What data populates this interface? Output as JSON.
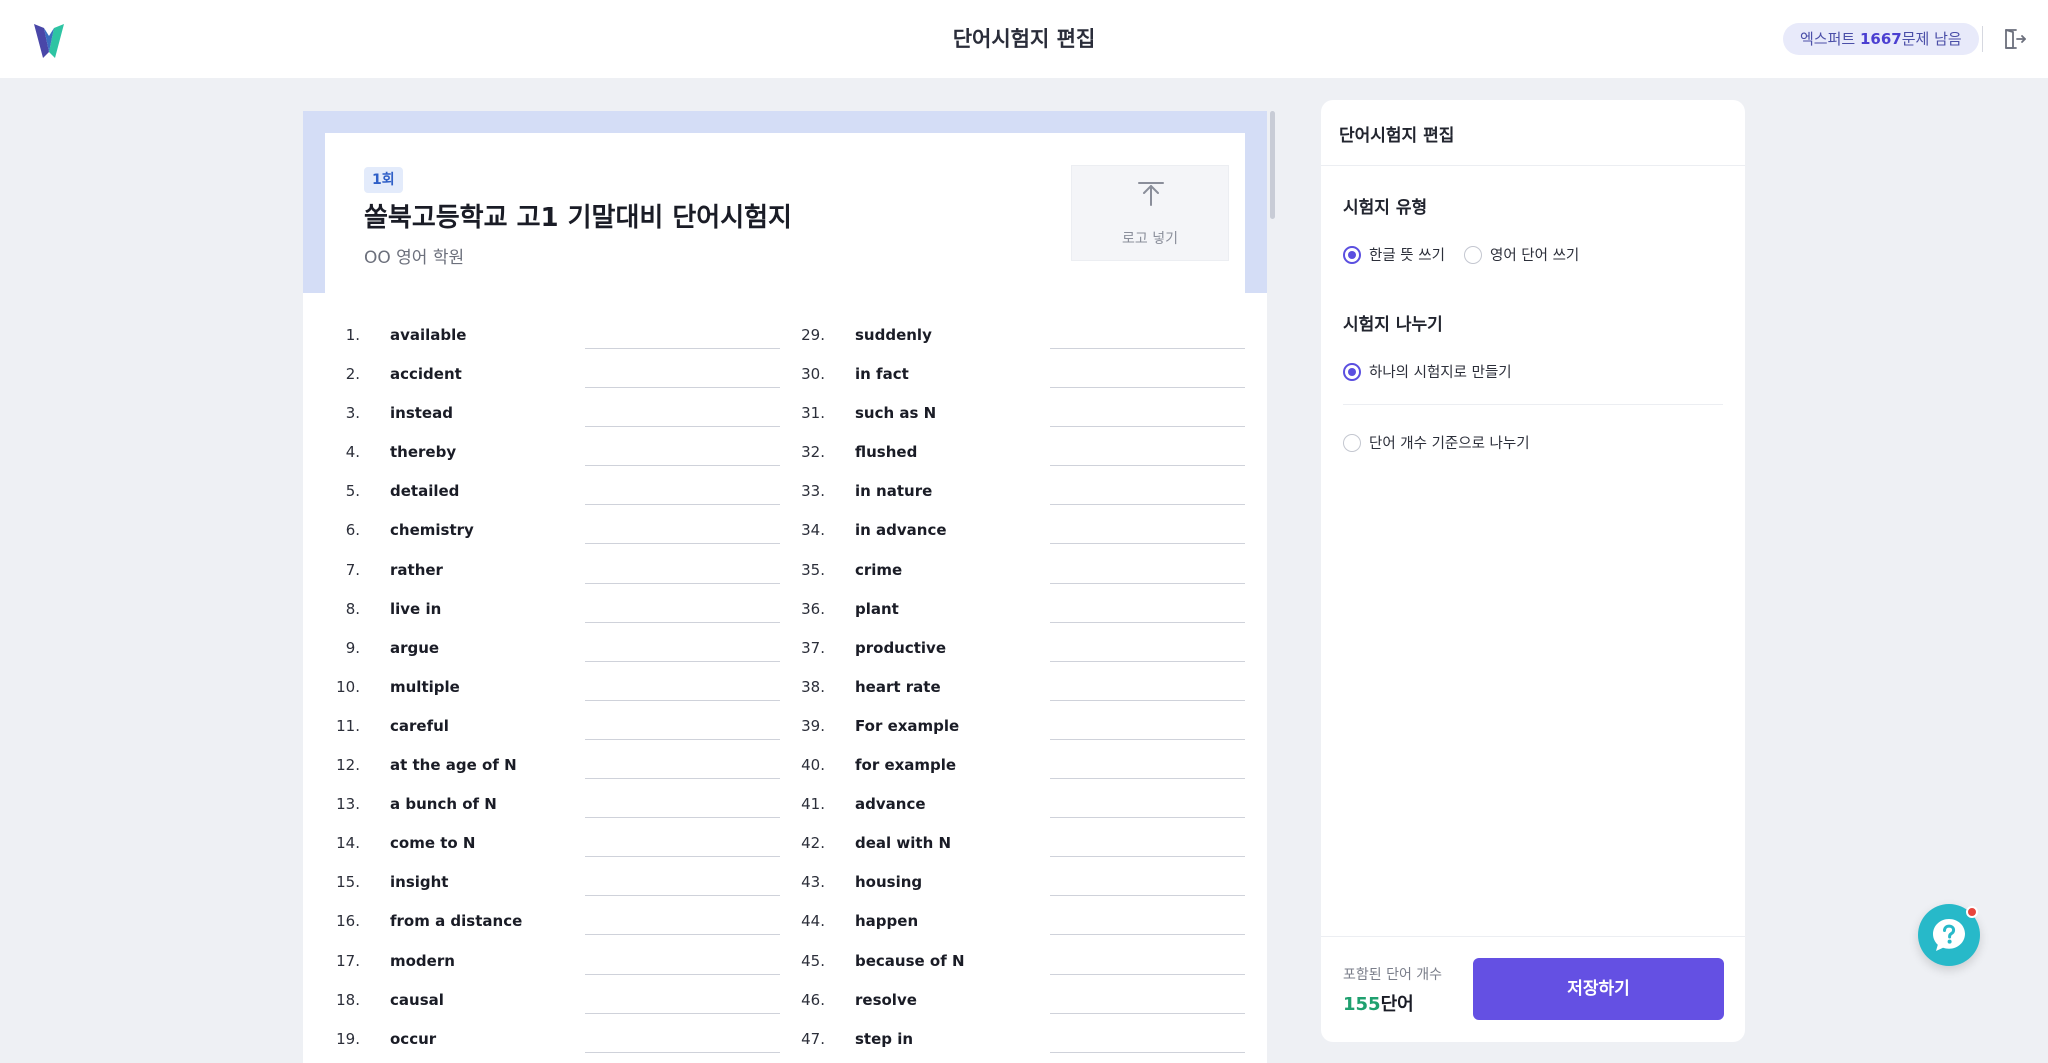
{
  "header": {
    "title": "단어시험지 편집",
    "credit_prefix": "엑스퍼트 ",
    "credit_count": "1667",
    "credit_suffix": "문제 남음"
  },
  "sheet": {
    "round_badge": "1회",
    "title": "쏠북고등학교 고1 기말대비 단어시험지",
    "subtitle": "OO 영어 학원",
    "logo_upload_label": "로고 넣기",
    "left_words": [
      {
        "num": "1.",
        "word": "available"
      },
      {
        "num": "2.",
        "word": "accident"
      },
      {
        "num": "3.",
        "word": "instead"
      },
      {
        "num": "4.",
        "word": "thereby"
      },
      {
        "num": "5.",
        "word": "detailed"
      },
      {
        "num": "6.",
        "word": "chemistry"
      },
      {
        "num": "7.",
        "word": "rather"
      },
      {
        "num": "8.",
        "word": "live in"
      },
      {
        "num": "9.",
        "word": "argue"
      },
      {
        "num": "10.",
        "word": "multiple"
      },
      {
        "num": "11.",
        "word": "careful"
      },
      {
        "num": "12.",
        "word": "at the age of N"
      },
      {
        "num": "13.",
        "word": "a bunch of N"
      },
      {
        "num": "14.",
        "word": "come to N"
      },
      {
        "num": "15.",
        "word": "insight"
      },
      {
        "num": "16.",
        "word": "from a distance"
      },
      {
        "num": "17.",
        "word": "modern"
      },
      {
        "num": "18.",
        "word": "causal"
      },
      {
        "num": "19.",
        "word": "occur"
      }
    ],
    "right_words": [
      {
        "num": "29.",
        "word": "suddenly"
      },
      {
        "num": "30.",
        "word": "in fact"
      },
      {
        "num": "31.",
        "word": "such as N"
      },
      {
        "num": "32.",
        "word": "flushed"
      },
      {
        "num": "33.",
        "word": "in nature"
      },
      {
        "num": "34.",
        "word": "in advance"
      },
      {
        "num": "35.",
        "word": "crime"
      },
      {
        "num": "36.",
        "word": "plant"
      },
      {
        "num": "37.",
        "word": "productive"
      },
      {
        "num": "38.",
        "word": "heart rate"
      },
      {
        "num": "39.",
        "word": "For example"
      },
      {
        "num": "40.",
        "word": "for example"
      },
      {
        "num": "41.",
        "word": "advance"
      },
      {
        "num": "42.",
        "word": "deal with N"
      },
      {
        "num": "43.",
        "word": "housing"
      },
      {
        "num": "44.",
        "word": "happen"
      },
      {
        "num": "45.",
        "word": "because of N"
      },
      {
        "num": "46.",
        "word": "resolve"
      },
      {
        "num": "47.",
        "word": "step in"
      }
    ]
  },
  "panel": {
    "title": "단어시험지 편집",
    "type_section": {
      "title": "시험지 유형",
      "options": [
        "한글 뜻 쓰기",
        "영어 단어 쓰기"
      ],
      "selected": "한글 뜻 쓰기"
    },
    "split_section": {
      "title": "시험지 나누기",
      "options": [
        "하나의 시험지로 만들기",
        "단어 개수 기준으로 나누기"
      ],
      "selected": "하나의 시험지로 만들기"
    },
    "count_label": "포함된 단어 개수",
    "count_number": "155",
    "count_unit": "단어",
    "save_label": "저장하기"
  },
  "colors": {
    "accent": "#6450e3",
    "count_green": "#1fa06f",
    "sheet_band": "#d4ddf6",
    "help_fab": "#27b9c9",
    "notification_dot": "#e8453c"
  },
  "icons": {
    "logo": "brand-logo-icon",
    "exit": "exit-door-icon",
    "upload": "upload-arrow-icon",
    "help": "chat-help-icon"
  }
}
